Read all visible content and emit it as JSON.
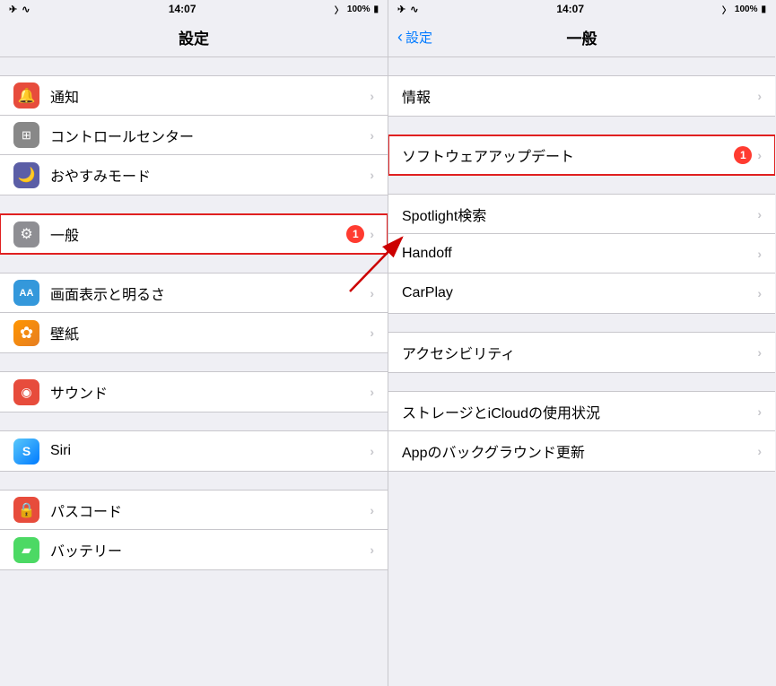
{
  "left_panel": {
    "status": {
      "time": "14:07",
      "battery": "100%"
    },
    "nav_title": "設定",
    "rows": [
      {
        "id": "notifications",
        "label": "通知",
        "icon_color": "#e74c3c",
        "icon_char": "🔔",
        "highlighted": false
      },
      {
        "id": "control_center",
        "label": "コントロールセンター",
        "icon_color": "#888888",
        "icon_char": "⊞",
        "highlighted": false
      },
      {
        "id": "dnd",
        "label": "おやすみモード",
        "icon_color": "#5b5ea6",
        "icon_char": "🌙",
        "highlighted": false
      },
      {
        "id": "general",
        "label": "一般",
        "icon_color": "#8e8e93",
        "icon_char": "⚙",
        "badge": "1",
        "highlighted": true
      },
      {
        "id": "display",
        "label": "画面表示と明るさ",
        "icon_color": "#3498db",
        "icon_char": "AA",
        "highlighted": false
      },
      {
        "id": "wallpaper",
        "label": "壁紙",
        "icon_color": "#ff9500",
        "icon_char": "✿",
        "highlighted": false
      },
      {
        "id": "sound",
        "label": "サウンド",
        "icon_color": "#e74c3c",
        "icon_char": "◉",
        "highlighted": false
      },
      {
        "id": "siri",
        "label": "Siri",
        "icon_color": "#5ac8fa",
        "icon_char": "S",
        "highlighted": false
      },
      {
        "id": "passcode",
        "label": "パスコード",
        "icon_color": "#e74c3c",
        "icon_char": "🔒",
        "highlighted": false
      },
      {
        "id": "battery",
        "label": "バッテリー",
        "icon_color": "#4cd964",
        "icon_char": "▰",
        "highlighted": false
      }
    ]
  },
  "right_panel": {
    "status": {
      "time": "14:07",
      "battery": "100%"
    },
    "nav_title": "一般",
    "back_label": "設定",
    "groups": [
      {
        "rows": [
          {
            "id": "info",
            "label": "情報",
            "highlighted": false
          }
        ]
      },
      {
        "rows": [
          {
            "id": "software_update",
            "label": "ソフトウェアアップデート",
            "badge": "1",
            "highlighted": true
          }
        ]
      },
      {
        "rows": [
          {
            "id": "spotlight",
            "label": "Spotlight検索",
            "highlighted": false
          },
          {
            "id": "handoff",
            "label": "Handoff",
            "highlighted": false
          },
          {
            "id": "carplay",
            "label": "CarPlay",
            "highlighted": false
          }
        ]
      },
      {
        "rows": [
          {
            "id": "accessibility",
            "label": "アクセシビリティ",
            "highlighted": false
          }
        ]
      },
      {
        "rows": [
          {
            "id": "storage",
            "label": "ストレージとiCloudの使用状況",
            "highlighted": false
          },
          {
            "id": "background",
            "label": "Appのバックグラウンド更新",
            "highlighted": false
          }
        ]
      }
    ]
  },
  "arrow": {
    "visible": true
  }
}
